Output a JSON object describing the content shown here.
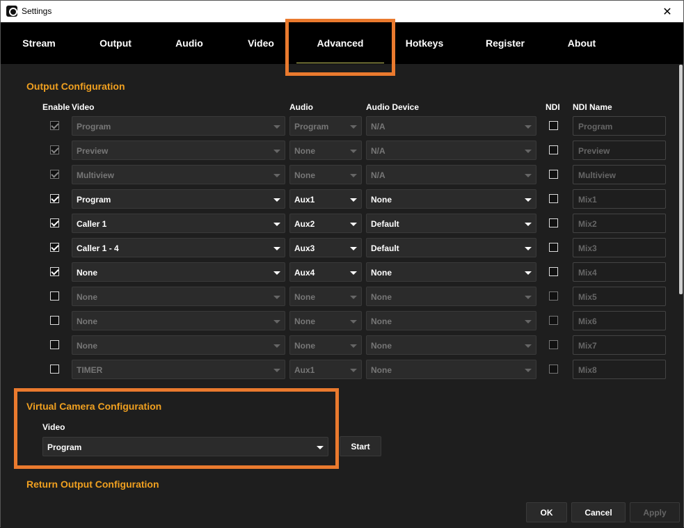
{
  "window": {
    "title": "Settings"
  },
  "tabs": [
    "Stream",
    "Output",
    "Audio",
    "Video",
    "Advanced",
    "Hotkeys",
    "Register",
    "About"
  ],
  "active_tab": "Advanced",
  "output_config": {
    "title": "Output Configuration",
    "headers": {
      "enable": "Enable",
      "video": "Video",
      "audio": "Audio",
      "audio_device": "Audio Device",
      "ndi": "NDI",
      "ndi_name": "NDI Name"
    },
    "rows": [
      {
        "enabled": true,
        "active": false,
        "video": "Program",
        "audio": "Program",
        "device": "N/A",
        "ndi": false,
        "ndi_name": "Program"
      },
      {
        "enabled": true,
        "active": false,
        "video": "Preview",
        "audio": "None",
        "device": "N/A",
        "ndi": false,
        "ndi_name": "Preview"
      },
      {
        "enabled": true,
        "active": false,
        "video": "Multiview",
        "audio": "None",
        "device": "N/A",
        "ndi": false,
        "ndi_name": "Multiview"
      },
      {
        "enabled": true,
        "active": true,
        "video": "Program",
        "audio": "Aux1",
        "device": "None",
        "ndi": false,
        "ndi_name": "Mix1"
      },
      {
        "enabled": true,
        "active": true,
        "video": "Caller 1",
        "audio": "Aux2",
        "device": "Default",
        "ndi": false,
        "ndi_name": "Mix2"
      },
      {
        "enabled": true,
        "active": true,
        "video": "Caller 1 - 4",
        "audio": "Aux3",
        "device": "Default",
        "ndi": false,
        "ndi_name": "Mix3"
      },
      {
        "enabled": true,
        "active": true,
        "video": "None",
        "audio": "Aux4",
        "device": "None",
        "ndi": false,
        "ndi_name": "Mix4"
      },
      {
        "enabled": false,
        "active": false,
        "video": "None",
        "audio": "None",
        "device": "None",
        "ndi": false,
        "ndi_name": "Mix5"
      },
      {
        "enabled": false,
        "active": false,
        "video": "None",
        "audio": "None",
        "device": "None",
        "ndi": false,
        "ndi_name": "Mix6"
      },
      {
        "enabled": false,
        "active": false,
        "video": "None",
        "audio": "None",
        "device": "None",
        "ndi": false,
        "ndi_name": "Mix7"
      },
      {
        "enabled": false,
        "active": false,
        "video": "TIMER",
        "audio": "Aux1",
        "device": "None",
        "ndi": false,
        "ndi_name": "Mix8"
      }
    ]
  },
  "virtual_camera": {
    "title": "Virtual Camera Configuration",
    "video_label": "Video",
    "video_value": "Program",
    "start_label": "Start"
  },
  "return_output": {
    "title": "Return Output Configuration"
  },
  "footer": {
    "ok": "OK",
    "cancel": "Cancel",
    "apply": "Apply"
  },
  "colors": {
    "accent": "#f0a020",
    "highlight": "#ea7a2e",
    "background": "#1e1e1e",
    "tabbar": "#000000"
  },
  "icons": {
    "close": "close-icon",
    "dropdown": "chevron-down-icon",
    "app": "app-logo-icon"
  }
}
